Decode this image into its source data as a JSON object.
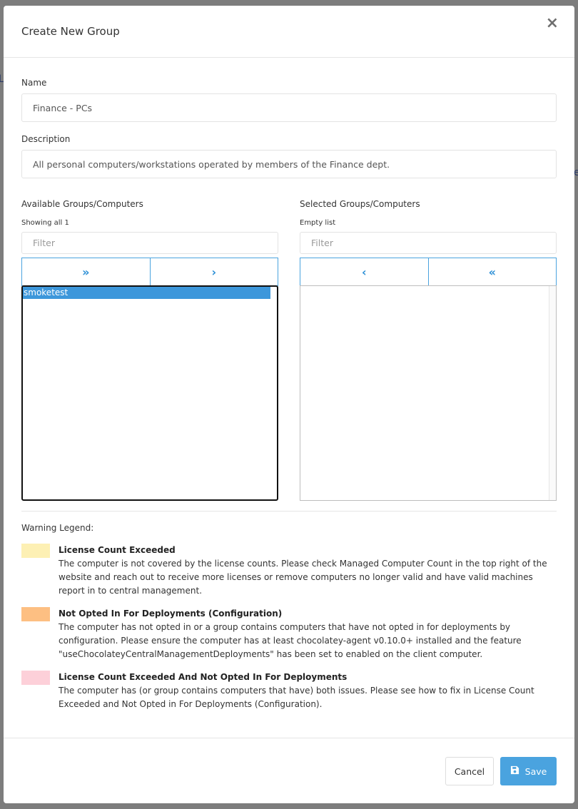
{
  "backdrop": {
    "left_text": "L",
    "right_text": "e"
  },
  "modal": {
    "title": "Create New Group",
    "close_glyph": "×"
  },
  "form": {
    "name_label": "Name",
    "name_value": "Finance - PCs",
    "description_label": "Description",
    "description_value": "All personal computers/workstations operated by members of the Finance dept."
  },
  "available": {
    "heading": "Available Groups/Computers",
    "count_text": "Showing all 1",
    "filter_placeholder": "Filter",
    "move_all_glyph": "»",
    "move_selected_glyph": "›",
    "items": [
      "smoketest"
    ]
  },
  "selected": {
    "heading": "Selected Groups/Computers",
    "count_text": "Empty list",
    "filter_placeholder": "Filter",
    "remove_selected_glyph": "‹",
    "remove_all_glyph": "«"
  },
  "legend": {
    "heading": "Warning Legend:",
    "entries": [
      {
        "title": "License Count Exceeded",
        "color": "#fdf0b4",
        "description": "The computer is not covered by the license counts. Please check Managed Computer Count in the top right of the website and reach out to receive more licenses or remove computers no longer valid and have valid machines report in to central management."
      },
      {
        "title": "Not Opted In For Deployments (Configuration)",
        "color": "#fdbf82",
        "description": "The computer has not opted in or a group contains computers that have not opted in for deployments by configuration. Please ensure the computer has at least chocolatey-agent v0.10.0+ installed and the feature \"useChocolateyCentralManagementDeployments\" has been set to enabled on the client computer."
      },
      {
        "title": "License Count Exceeded And Not Opted In For Deployments",
        "color": "#fdd0d9",
        "description": "The computer has (or group contains computers that have) both issues. Please see how to fix in License Count Exceeded and Not Opted in For Deployments (Configuration)."
      }
    ]
  },
  "footer": {
    "cancel_label": "Cancel",
    "save_label": "Save"
  },
  "colors": {
    "accent": "#4aa3df",
    "selection": "#3d97db"
  }
}
